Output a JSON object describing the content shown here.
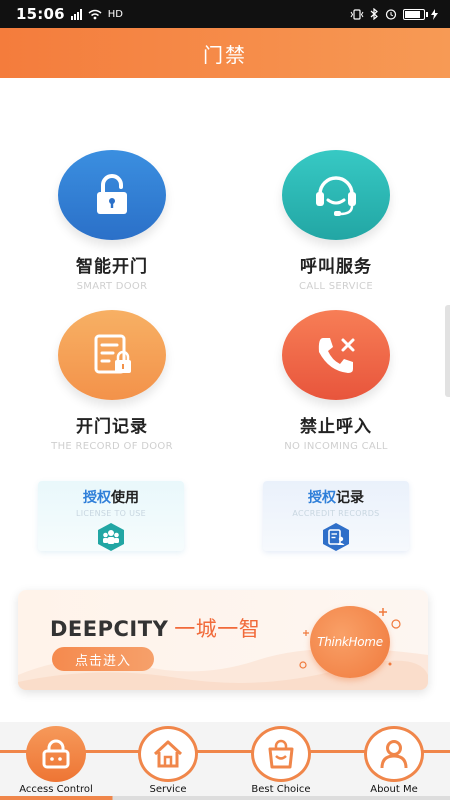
{
  "status_bar": {
    "time": "15:06",
    "left_icons": [
      "signal-icon",
      "wifi-icon",
      "hd-icon"
    ],
    "hd_label": "HD",
    "right_icons": [
      "vibrate-icon",
      "bluetooth-icon",
      "alarm-icon",
      "battery-icon",
      "charging-icon"
    ],
    "battery_level": 0.75
  },
  "header": {
    "title": "门禁"
  },
  "features": [
    {
      "label": "智能开门",
      "sub": "SMART DOOR",
      "icon": "unlock-icon"
    },
    {
      "label": "呼叫服务",
      "sub": "CALL SERVICE",
      "icon": "headset-icon"
    },
    {
      "label": "开门记录",
      "sub": "THE RECORD OF DOOR",
      "icon": "record-lock-icon"
    },
    {
      "label": "禁止呼入",
      "sub": "NO INCOMING CALL",
      "icon": "phone-block-icon"
    }
  ],
  "cards": {
    "license": {
      "title_hl": "授权",
      "title_rest": "使用",
      "sub": "LICENSE TO USE",
      "icon": "users-icon"
    },
    "accredit": {
      "title_hl": "授权",
      "title_rest": "记录",
      "sub": "ACCREDIT RECORDS",
      "icon": "record-user-icon"
    }
  },
  "banner": {
    "brand": "DEEPCITY",
    "slogan": "一城一智",
    "button": "点击进入",
    "logo_text": "ThinkHome"
  },
  "bottom_nav": [
    {
      "label": "Access Control",
      "icon": "lock-icon",
      "active": true
    },
    {
      "label": "Service",
      "icon": "home-icon",
      "active": false
    },
    {
      "label": "Best Choice",
      "icon": "shopping-bag-icon",
      "active": false
    },
    {
      "label": "About Me",
      "icon": "user-icon",
      "active": false
    }
  ],
  "colors": {
    "accent": "#f47c3c",
    "blue": "#2f7fd9",
    "teal": "#22a6a4"
  }
}
